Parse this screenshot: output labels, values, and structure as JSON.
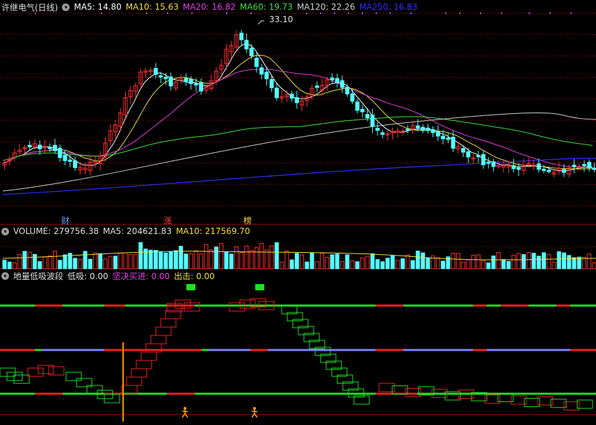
{
  "stock": {
    "title": "许继电气(日线)"
  },
  "price_panel": {
    "ma_legend": [
      {
        "text": "MA5: 14.80",
        "color": "#ffffff"
      },
      {
        "text": "MA10: 15.63",
        "color": "#f0e040"
      },
      {
        "text": "MA20: 16.82",
        "color": "#e040e0"
      },
      {
        "text": "MA60: 19.73",
        "color": "#40e040"
      },
      {
        "text": "MA120: 22.26",
        "color": "#d0d0d0"
      },
      {
        "text": "MA250: 16.83",
        "color": "#3030ff"
      }
    ],
    "peak_label": "33.10",
    "markers": [
      {
        "text": "财",
        "color": "#60a0ff"
      },
      {
        "text": "涨",
        "color": "#ff4040"
      },
      {
        "text": "榜",
        "color": "#ffd040"
      }
    ]
  },
  "volume_panel": {
    "title": "VOLUME: 279756.38",
    "ma5": "MA5: 204621.83",
    "ma10": "MA10: 217569.70"
  },
  "indicator_panel": {
    "name": "地量低吸波段",
    "low_buy": "低吸: 0.00",
    "firm_buy": "坚决买进: 0.00",
    "exit": "出击: 0.00"
  },
  "colors": {
    "up": "#ff3030",
    "down": "#54ffff",
    "grid": "#8b0000",
    "panel_border": "#aa0000",
    "indicator_green": "#20e020",
    "indicator_red": "#ee2020",
    "mid_line": "#8080ff",
    "signal_orange": "#ff9000"
  },
  "icons": [
    "settings-circle-icon",
    "walking-person-icon",
    "green-square-signal-icon"
  ]
}
